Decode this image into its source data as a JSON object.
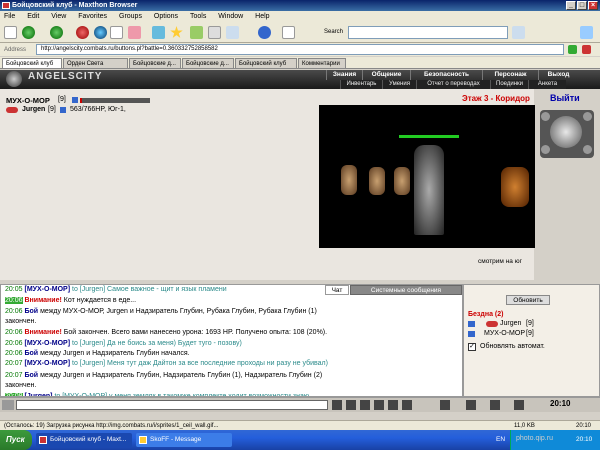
{
  "window": {
    "title": "Бойцовский клуб - Maxthon Browser"
  },
  "menu": [
    "File",
    "Edit",
    "View",
    "Favorites",
    "Groups",
    "Options",
    "Tools",
    "Window",
    "Help"
  ],
  "toolbar": {
    "search_label": "Search",
    "search_placeholder": ""
  },
  "address": {
    "label": "Address",
    "url": "http://angelscity.combats.ru/buttons.pl?battle=0.360332752858582"
  },
  "tabs": [
    "Бойцовский клуб",
    "Орден Света",
    "Бойцовские д...",
    "Бойцовские д...",
    "Бойцовский клуб",
    "Комментарии"
  ],
  "game": {
    "logo": "ANGELSCITY",
    "nav_top": [
      "Знания",
      "Общение",
      "Безопасность",
      "Персонаж",
      "Выход"
    ],
    "nav_bottom": [
      "Инвентарь",
      "Умения",
      "Отчет о переводах",
      "Поединки",
      "Анкета"
    ],
    "player": {
      "name": "МУХ-О-МОР",
      "level": "[9]",
      "hp_fraction": 0.03
    },
    "opponent": {
      "name": "Jurgen",
      "level": "[9]",
      "hp": "563/766HP, Юг-1,"
    },
    "location": {
      "text": "Этаж 3 - Коридор",
      "exit": "Выйти"
    },
    "scene_caption": "смотрим на юг"
  },
  "chat": {
    "tabs": [
      "Чат",
      "Системные сообщения"
    ],
    "lines": [
      {
        "time": "20:05",
        "highlight": false,
        "sender": "[МУХ-О-МОР]",
        "text": "to [Jurgen] Самое важное - щит и язык пламени"
      },
      {
        "time": "20:06",
        "highlight": true,
        "sender": "Внимание!",
        "text": "Кот нуждается в еде..."
      },
      {
        "time": "20:06",
        "highlight": false,
        "sender": "Бой",
        "text": "между МУХ-О-МОР, Jurgen   и  Надзиратель Глубин, Рубака Глубин, Рубака Глубин (1)"
      },
      {
        "time": "",
        "highlight": false,
        "sender": "",
        "text": "закончен."
      },
      {
        "time": "20:06",
        "highlight": false,
        "sender": "Внимание!",
        "text": "Бой закончен. Всего вами нанесено урона: 1693 HP. Получено опыта: 108 (20%)."
      },
      {
        "time": "20:06",
        "highlight": false,
        "sender": "[МУХ-О-МОР]",
        "text": "to [Jurgen] Да не боись за меня) Будет туго - позову)"
      },
      {
        "time": "20:06",
        "highlight": false,
        "sender": "Бой",
        "text": "между Jurgen и Надзиратель Глубин начался."
      },
      {
        "time": "20:07",
        "highlight": false,
        "sender": "[МУХ-О-МОР]",
        "text": "to [Jurgen] Меня тут даж Дайтон за все последние проходы ни разу не убивал)"
      },
      {
        "time": "20:07",
        "highlight": false,
        "sender": "Бой",
        "text": "между Jurgen   и  Надзиратель Глубин, Надзиратель Глубин (1), Надзиратель Глубин (2)"
      },
      {
        "time": "",
        "highlight": false,
        "sender": "",
        "text": "закончен."
      },
      {
        "time": "20:08",
        "highlight": true,
        "sender": "[Jurgen]",
        "text": "to [МУХ-О-МОР] у меня земляк в такомже комплекте ходит возможности знаю"
      }
    ]
  },
  "side": {
    "refresh_button": "Обновить",
    "room": "Бездна (2)",
    "users": [
      {
        "name": "Jurgen",
        "level": "[9]"
      },
      {
        "name": "МУХ-О-МОР",
        "level": "[9]"
      }
    ],
    "auto_refresh_label": "Обновлять автомат."
  },
  "clock": "20:10",
  "status": {
    "text": "(Осталось: 19) Загрузка рисунка http://img.combats.ru/i/sprites/1_ceil_wall.gif...",
    "size": "11,0 KB",
    "time": "20:10"
  },
  "taskbar": {
    "start": "Пуск",
    "items": [
      "Бойцовский клуб - Maxt...",
      "SkoFF - Message"
    ],
    "lang": "EN",
    "tray_time": "20:10",
    "watermark": "photo.qip.ru"
  },
  "colors": {
    "title": "#0a246a",
    "taskbar": "#245edb",
    "timestamp": "#007700",
    "sender": "#000088",
    "location": "#cc0000"
  }
}
